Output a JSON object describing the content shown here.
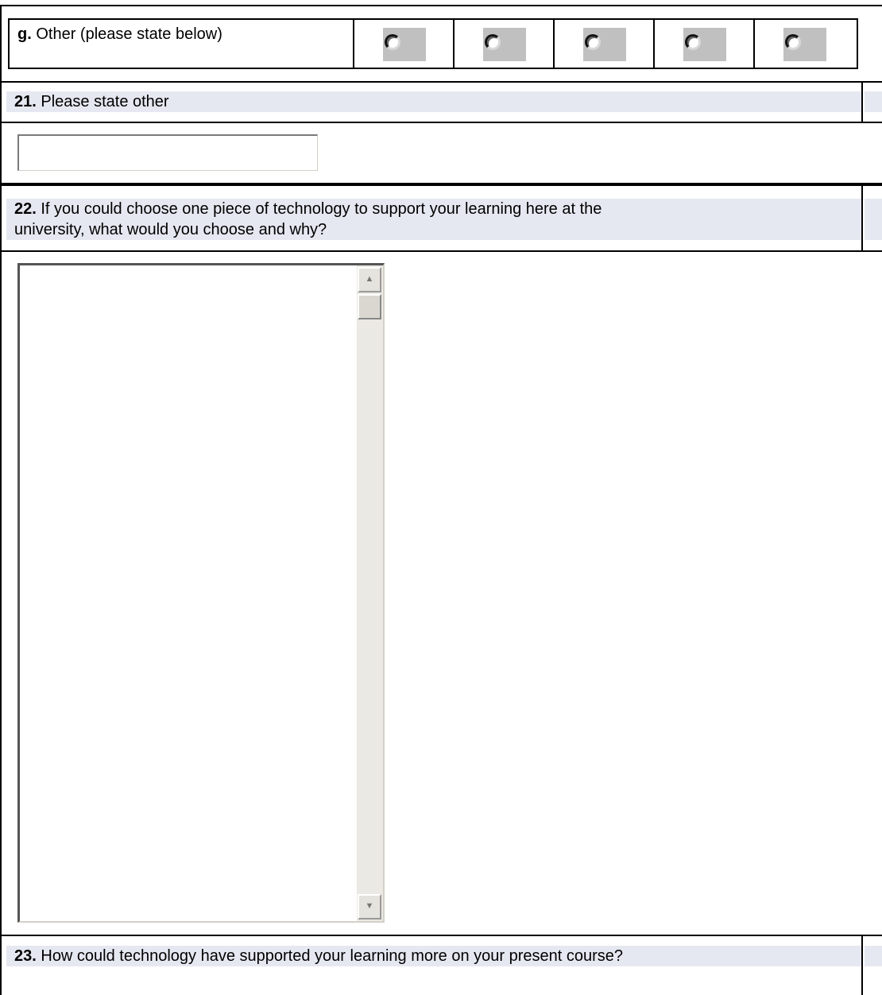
{
  "rating_row": {
    "label_bold": "g.",
    "label_text": " Other (please state below)",
    "option_count": 5
  },
  "q21": {
    "number": "21.",
    "text": " Please state other",
    "input_value": ""
  },
  "q22": {
    "number": "22.",
    "line1": " If you could choose one piece of technology to support your learning here at the",
    "line2": "university, what would you choose and why?",
    "textarea_value": ""
  },
  "q23": {
    "number": "23.",
    "text": " How could technology have supported your learning more on your present course?"
  },
  "colors": {
    "question_bar": "#e6e8f1",
    "radio_box": "#c0c0c0"
  },
  "icons": {
    "scroll_up": "scroll-up-arrow-icon",
    "scroll_down": "scroll-down-arrow-icon"
  }
}
